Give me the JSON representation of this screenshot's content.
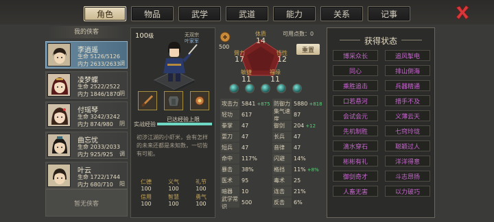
{
  "tabs": [
    {
      "label": "角色",
      "active": true
    },
    {
      "label": "物品",
      "active": false
    },
    {
      "label": "武学",
      "active": false
    },
    {
      "label": "武道",
      "active": false
    },
    {
      "label": "能力",
      "active": false
    },
    {
      "label": "关系",
      "active": false
    },
    {
      "label": "记事",
      "active": false
    }
  ],
  "members_title": "我的侠客",
  "members": [
    {
      "name": "李逍遥",
      "hp_label": "生命",
      "hp": "5126/5126",
      "mp_label": "内力",
      "mp": "2633/2633",
      "tag": "调",
      "active": true,
      "avatar_bg": "#c6b79a"
    },
    {
      "name": "凌梦蝶",
      "hp_label": "生命",
      "hp": "2522/2522",
      "mp_label": "内力",
      "mp": "1846/1870",
      "tag": "阴",
      "active": false,
      "avatar_bg": "#d2c1a8"
    },
    {
      "name": "付瑶琴",
      "hp_label": "生命",
      "hp": "3242/3242",
      "mp_label": "内力",
      "mp": "874/980",
      "tag": "阴",
      "active": false,
      "avatar_bg": "#cfc0a9"
    },
    {
      "name": "曲忘忧",
      "hp_label": "生命",
      "hp": "2033/2033",
      "mp_label": "内力",
      "mp": "925/925",
      "tag": "调",
      "active": false,
      "avatar_bg": "#c8baa2"
    },
    {
      "name": "叶云",
      "hp_label": "生命",
      "hp": "1722/1744",
      "mp_label": "内力",
      "mp": "680/710",
      "tag": "阳",
      "active": false,
      "avatar_bg": "#cbbd9f"
    }
  ],
  "empty_slot": "暂无侠客",
  "character": {
    "level": "100",
    "level_unit": "级",
    "faction_top": "无双宗",
    "faction_sub": "叶家军",
    "exp_label": "实战经验",
    "exp_text": "已达经验上限",
    "exp_fill": 1.0,
    "bio": "初涉江湖的小虾米，会有怎样的未来还都是未知数，一切皆有可能。",
    "bottom_stats": [
      {
        "k": "仁德",
        "v": "100"
      },
      {
        "k": "义气",
        "v": "100"
      },
      {
        "k": "礼节",
        "v": "100"
      },
      {
        "k": "信用",
        "v": "100"
      },
      {
        "k": "智慧",
        "v": "100"
      },
      {
        "k": "勇气",
        "v": "100"
      }
    ]
  },
  "points": {
    "label": "可用点数：",
    "value": "0",
    "coin": "500"
  },
  "reset_label": "重置",
  "attributes": {
    "tizhi": {
      "label": "体质",
      "value": "14"
    },
    "bili": {
      "label": "臂力",
      "value": "17"
    },
    "wuxing": {
      "label": "悟性",
      "value": "12"
    },
    "minjie": {
      "label": "敏捷",
      "value": "11"
    },
    "fuyuan": {
      "label": "福缘",
      "value": "11"
    }
  },
  "stats": [
    [
      {
        "k": "攻击力",
        "v": "5841",
        "plus": "+875"
      },
      {
        "k": "防御力",
        "v": "5880",
        "plus": "+818"
      }
    ],
    [
      {
        "k": "轻功",
        "v": "617",
        "plus": ""
      },
      {
        "k": "集气速度",
        "v": "87",
        "plus": ""
      }
    ],
    [
      {
        "k": "拳掌",
        "v": "47",
        "plus": ""
      },
      {
        "k": "御剑",
        "v": "204",
        "plus": "+12"
      }
    ],
    [
      {
        "k": "耍刀",
        "v": "47",
        "plus": ""
      },
      {
        "k": "长兵",
        "v": "47",
        "plus": ""
      }
    ],
    [
      {
        "k": "短兵",
        "v": "47",
        "plus": ""
      },
      {
        "k": "音律",
        "v": "47",
        "plus": ""
      }
    ],
    [
      {
        "k": "命中",
        "v": "117%",
        "plus": ""
      },
      {
        "k": "闪避",
        "v": "14%",
        "plus": ""
      }
    ],
    [
      {
        "k": "暴击",
        "v": "38%",
        "plus": ""
      },
      {
        "k": "格挡",
        "v": "11%",
        "plus": "+8%"
      }
    ],
    [
      {
        "k": "医术",
        "v": "95",
        "plus": ""
      },
      {
        "k": "毒术",
        "v": "25",
        "plus": ""
      }
    ],
    [
      {
        "k": "暗器",
        "v": "10",
        "plus": ""
      },
      {
        "k": "连击",
        "v": "21%",
        "plus": ""
      }
    ],
    [
      {
        "k": "武学常识",
        "v": "500",
        "plus": ""
      },
      {
        "k": "反击",
        "v": "6%",
        "plus": ""
      }
    ]
  ],
  "states_title": "获得状态",
  "states": [
    "博采众长",
    "追风掣电",
    "同心",
    "排山倒海",
    "乘胜追击",
    "兵器精通",
    "口若悬河",
    "措手不及",
    "会试会元",
    "义薄云天",
    "先机制胜",
    "七窍玲珑",
    "滴水穿石",
    "聪颖过人",
    "彬彬有礼",
    "洋洋得意",
    "御剑奇才",
    "斗志昂扬",
    "人畜无害",
    "以力破巧"
  ],
  "colors": {
    "accent": "#6fd8c5",
    "state_text": "#c767cf",
    "plus_green": "#5bd27a",
    "close_red": "#d9383a"
  }
}
